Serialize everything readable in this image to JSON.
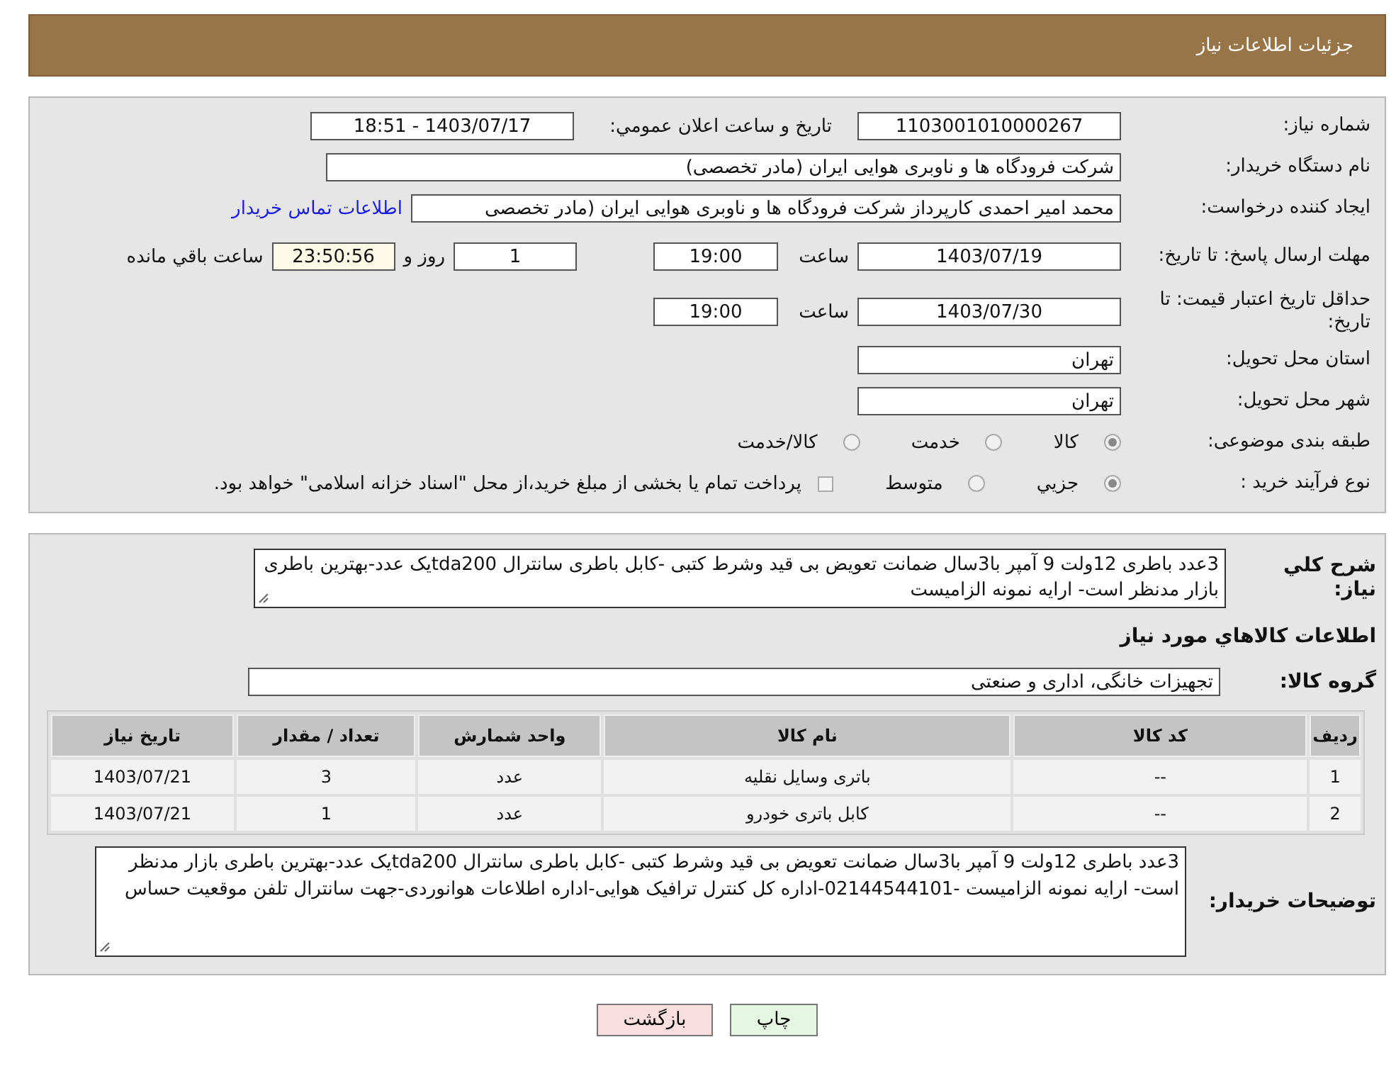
{
  "header": {
    "title": "جزئیات اطلاعات نیاز"
  },
  "info": {
    "need_number": {
      "label": "شماره نیاز:",
      "value": "1103001010000267"
    },
    "announce": {
      "label": "تاریخ و ساعت اعلان عمومي:",
      "value": "1403/07/17 - 18:51"
    },
    "buyer_org": {
      "label": "نام دستگاه خریدار:",
      "value": "شرکت فرودگاه ها و ناوبری هوایی ایران (مادر تخصصی)"
    },
    "requester": {
      "label": "ایجاد کننده درخواست:",
      "value": "محمد امیر احمدی کارپرداز شرکت فرودگاه ها و ناوبری هوایی ایران (مادر تخصصی",
      "link": "اطلاعات تماس خریدار"
    },
    "reply_deadline": {
      "label": "مهلت ارسال پاسخ: تا تاریخ:",
      "date": "1403/07/19",
      "time_label": "ساعت",
      "time": "19:00",
      "days": "1",
      "days_label": "روز و",
      "remaining": "23:50:56",
      "remaining_label": "ساعت باقي مانده"
    },
    "price_validity": {
      "label": "حداقل تاریخ اعتبار قیمت: تا تاریخ:",
      "date": "1403/07/30",
      "time_label": "ساعت",
      "time": "19:00"
    },
    "province": {
      "label": "استان محل تحویل:",
      "value": "تهران"
    },
    "city": {
      "label": "شهر محل تحویل:",
      "value": "تهران"
    },
    "category": {
      "label": "طبقه بندی موضوعی:",
      "options": [
        {
          "label": "کالا",
          "selected": true
        },
        {
          "label": "خدمت",
          "selected": false
        },
        {
          "label": "کالا/خدمت",
          "selected": false
        }
      ]
    },
    "purchase_type": {
      "label": "نوع فرآیند خرید :",
      "options": [
        {
          "label": "جزيي",
          "selected": true
        },
        {
          "label": "متوسط",
          "selected": false
        }
      ],
      "treasury": {
        "label": "پرداخت تمام یا بخشی از مبلغ خرید،از محل \"اسناد خزانه اسلامی\" خواهد بود.",
        "checked": false
      }
    }
  },
  "description": {
    "label": "شرح کلي نیاز:",
    "value": "3عدد باطری 12ولت 9 آمپر با3سال ضمانت تعویض بی قید وشرط کتبی -کابل باطری سانترال tda200یک عدد-بهترین باطری بازار مدنظر است- ارایه نمونه الزامیست"
  },
  "goods_heading": "اطلاعات کالاهاي مورد نياز",
  "goods_group": {
    "label": "گروه کالا:",
    "value": "تجهیزات خانگی، اداری و صنعتی"
  },
  "table": {
    "columns": [
      "ردیف",
      "کد کالا",
      "نام کالا",
      "واحد شمارش",
      "تعداد / مقدار",
      "تاریخ نیاز"
    ],
    "rows": [
      [
        "1",
        "--",
        "باتری وسایل نقلیه",
        "عدد",
        "3",
        "1403/07/21"
      ],
      [
        "2",
        "--",
        "کابل باتری خودرو",
        "عدد",
        "1",
        "1403/07/21"
      ]
    ]
  },
  "buyer_notes": {
    "label": "توضیحات خریدار:",
    "value": "3عدد باطری 12ولت 9 آمپر با3سال ضمانت تعویض بی قید وشرط کتبی -کابل باطری سانترال tda200یک عدد-بهترین باطری بازار مدنظر است- ارایه نمونه الزامیست -02144544101-اداره کل کنترل ترافیک هوایی-اداره اطلاعات هوانوردی-جهت سانترال تلفن موقعیت حساس"
  },
  "buttons": [
    {
      "label": "چاپ",
      "kind": "print"
    },
    {
      "label": "بازگشت",
      "kind": "back"
    }
  ]
}
